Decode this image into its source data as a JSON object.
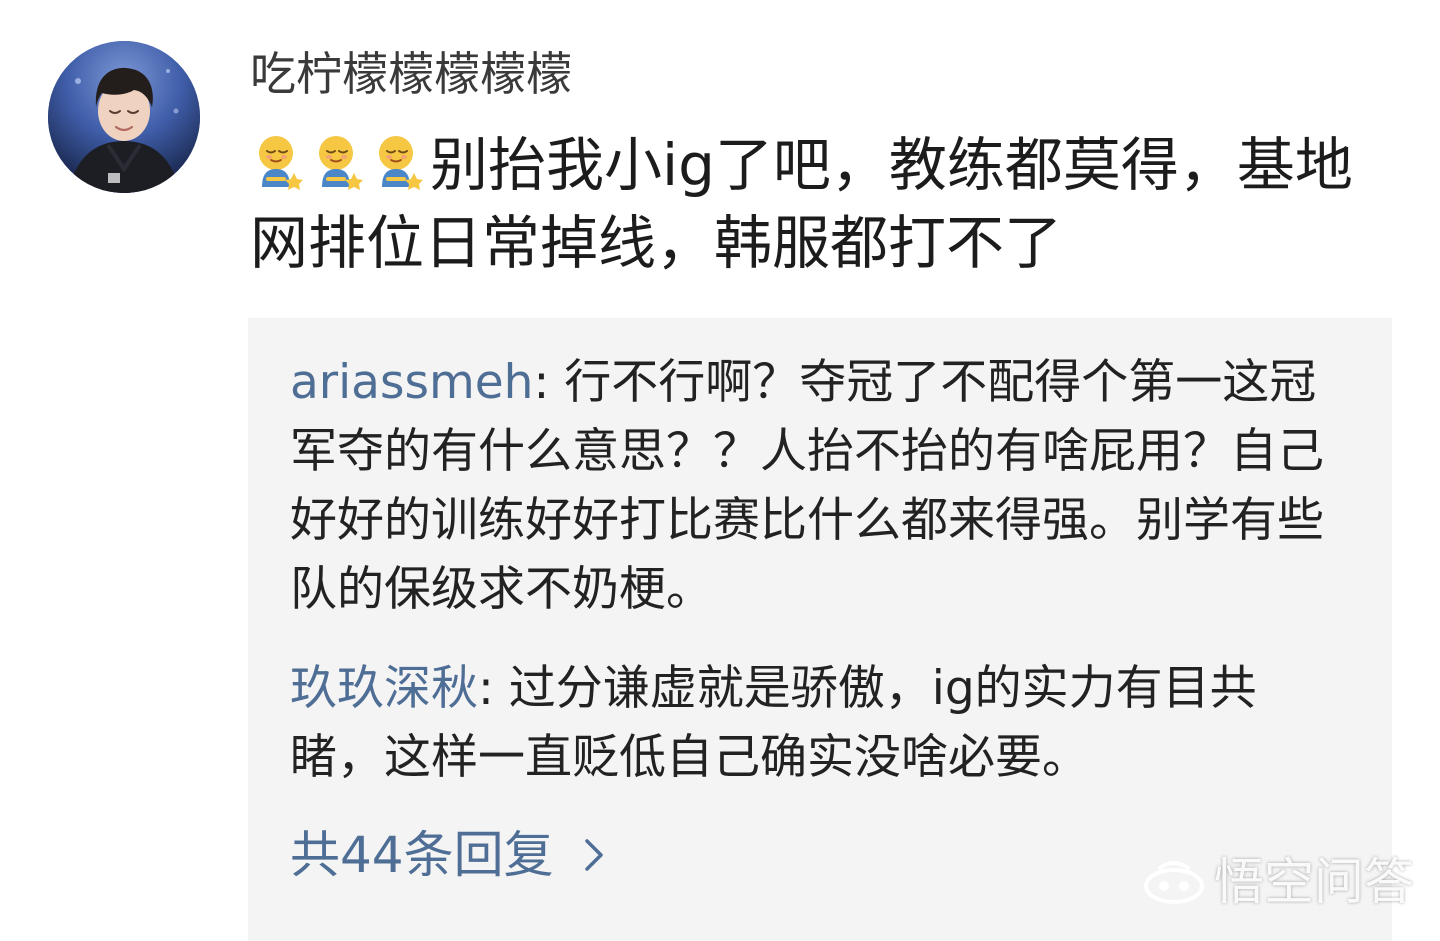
{
  "post": {
    "username": "吃柠檬檬檬檬檬",
    "emojis": [
      "sheepish-emoji",
      "sheepish-emoji",
      "sheepish-emoji"
    ],
    "text": "别抬我小ig了吧，教练都莫得，基地网排位日常掉线，韩服都打不了"
  },
  "replies": [
    {
      "author": "ariassmeh",
      "separator": ": ",
      "text": "行不行啊？夺冠了不配得个第一这冠军夺的有什么意思？？人抬不抬的有啥屁用？自己好好的训练好好打比赛比什么都来得强。别学有些队的保级求不奶梗。"
    },
    {
      "author": "玖玖深秋",
      "separator": ": ",
      "text": "过分谦虚就是骄傲，ig的实力有目共睹，这样一直贬低自己确实没啥必要。"
    }
  ],
  "more_replies": {
    "label": "共44条回复",
    "icon": "chevron-right-icon"
  },
  "watermark": {
    "text": "悟空问答",
    "icon": "wukong-logo"
  },
  "colors": {
    "link": "#4f6e95",
    "reply_bg": "#f4f4f4",
    "text": "#222222",
    "username": "#3a3a3a"
  }
}
